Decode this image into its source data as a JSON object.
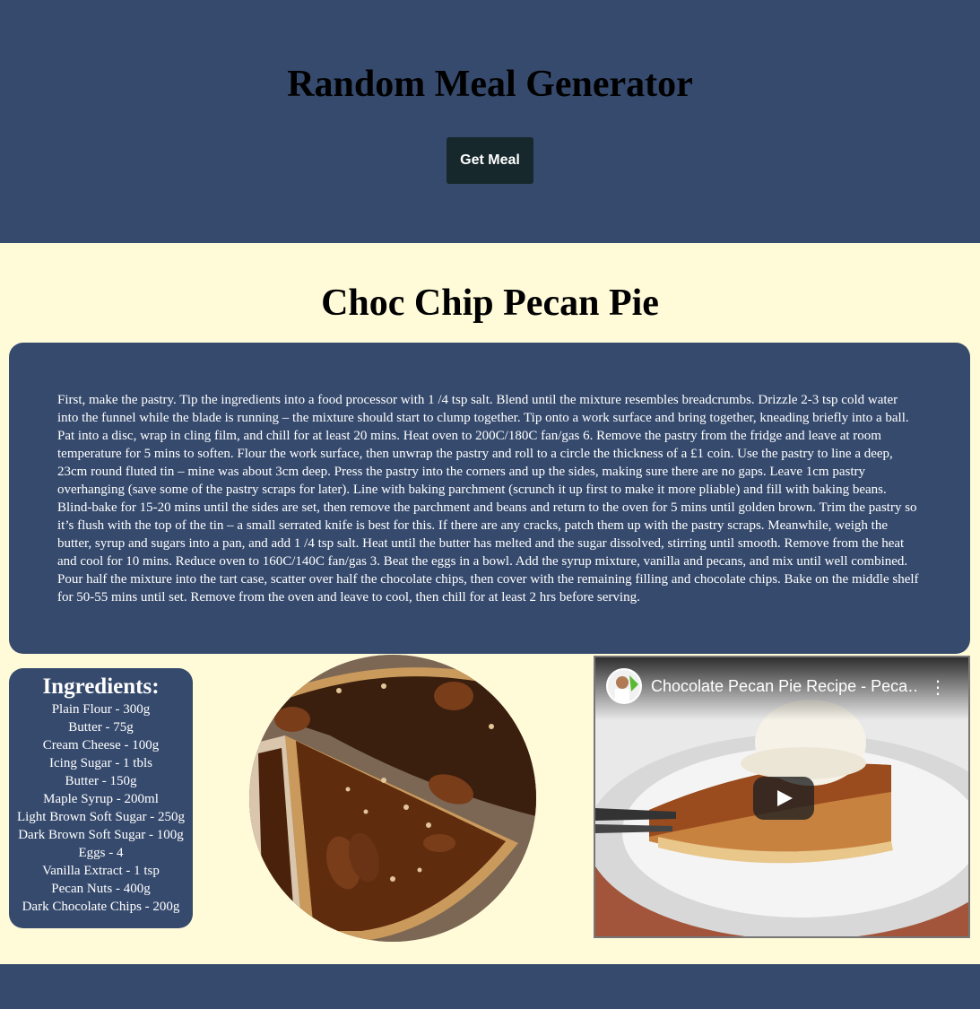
{
  "header": {
    "title": "Random Meal Generator",
    "button_label": "Get Meal"
  },
  "meal": {
    "name": "Choc Chip Pecan Pie",
    "instructions": "First, make the pastry. Tip the ingredients into a food processor with 1 /4 tsp salt. Blend until the mixture resembles breadcrumbs. Drizzle 2-3 tsp cold water into the funnel while the blade is running – the mixture should start to clump together. Tip onto a work surface and bring together, kneading briefly into a ball. Pat into a disc, wrap in cling film, and chill for at least 20 mins. Heat oven to 200C/180C fan/gas 6. Remove the pastry from the fridge and leave at room temperature for 5 mins to soften. Flour the work surface, then unwrap the pastry and roll to a circle the thickness of a £1 coin. Use the pastry to line a deep, 23cm round fluted tin – mine was about 3cm deep. Press the pastry into the corners and up the sides, making sure there are no gaps. Leave 1cm pastry overhanging (save some of the pastry scraps for later). Line with baking parchment (scrunch it up first to make it more pliable) and fill with baking beans. Blind-bake for 15-20 mins until the sides are set, then remove the parchment and beans and return to the oven for 5 mins until golden brown. Trim the pastry so it’s flush with the top of the tin – a small serrated knife is best for this. If there are any cracks, patch them up with the pastry scraps. Meanwhile, weigh the butter, syrup and sugars into a pan, and add 1 /4 tsp salt. Heat until the butter has melted and the sugar dissolved, stirring until smooth. Remove from the heat and cool for 10 mins. Reduce oven to 160C/140C fan/gas 3. Beat the eggs in a bowl. Add the syrup mixture, vanilla and pecans, and mix until well combined. Pour half the mixture into the tart case, scatter over half the chocolate chips, then cover with the remaining filling and chocolate chips. Bake on the middle shelf for 50-55 mins until set. Remove from the oven and leave to cool, then chill for at least 2 hrs before serving."
  },
  "ingredients": {
    "title": "Ingredients:",
    "items": [
      "Plain Flour - 300g",
      "Butter - 75g",
      "Cream Cheese - 100g",
      "Icing Sugar - 1 tbls",
      "Butter - 150g",
      "Maple Syrup - 200ml",
      "Light Brown Soft Sugar - 250g",
      "Dark Brown Soft Sugar - 100g",
      "Eggs - 4",
      "Vanilla Extract - 1 tsp",
      "Pecan Nuts - 400g",
      "Dark Chocolate Chips - 200g"
    ]
  },
  "video": {
    "title": "Chocolate Pecan Pie Recipe - Peca…",
    "menu_icon": "kebab-menu-icon",
    "play_icon": "play-icon"
  },
  "colors": {
    "navy": "#364a6d",
    "cream": "#fffbd9",
    "button": "#16282b"
  }
}
